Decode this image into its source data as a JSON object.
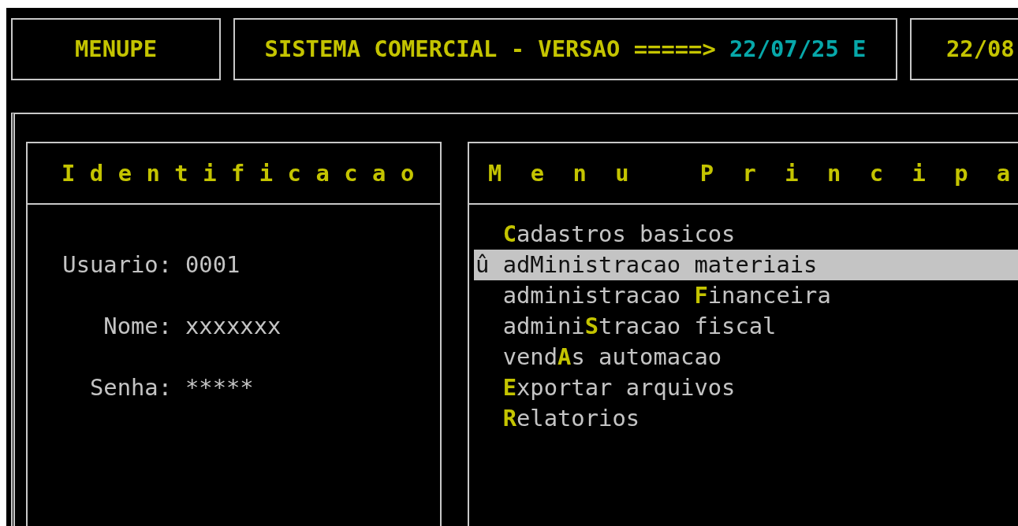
{
  "header": {
    "program": "MENUPE",
    "system_label": "SISTEMA COMERCIAL - VERSAO =====>",
    "version": "22/07/25 E",
    "date": "22/08"
  },
  "identification": {
    "title": "I d e n t i f i c a c a o",
    "fields": [
      {
        "label": "Usuario:",
        "value": "0001"
      },
      {
        "label": "Nome:",
        "value": "xxxxxxx"
      },
      {
        "label": "Senha:",
        "value": "*****"
      }
    ]
  },
  "menu": {
    "title": "M  e  n  u     P  r  i  n  c  i  p  a",
    "items": [
      {
        "hotkey": "C",
        "after": "adastros basicos",
        "selected": false
      },
      {
        "marker": "û",
        "before": "ad",
        "hotkey": "M",
        "after": "inistracao materiais",
        "selected": true
      },
      {
        "before": "administracao ",
        "hotkey": "F",
        "after": "inanceira",
        "selected": false
      },
      {
        "before": "admini",
        "hotkey": "S",
        "after": "tracao fiscal",
        "selected": false
      },
      {
        "before": "vend",
        "hotkey": "A",
        "after": "s automacao",
        "selected": false
      },
      {
        "hotkey": "E",
        "after": "xportar arquivos",
        "selected": false
      },
      {
        "hotkey": "R",
        "after": "elatorios",
        "selected": false
      }
    ]
  }
}
